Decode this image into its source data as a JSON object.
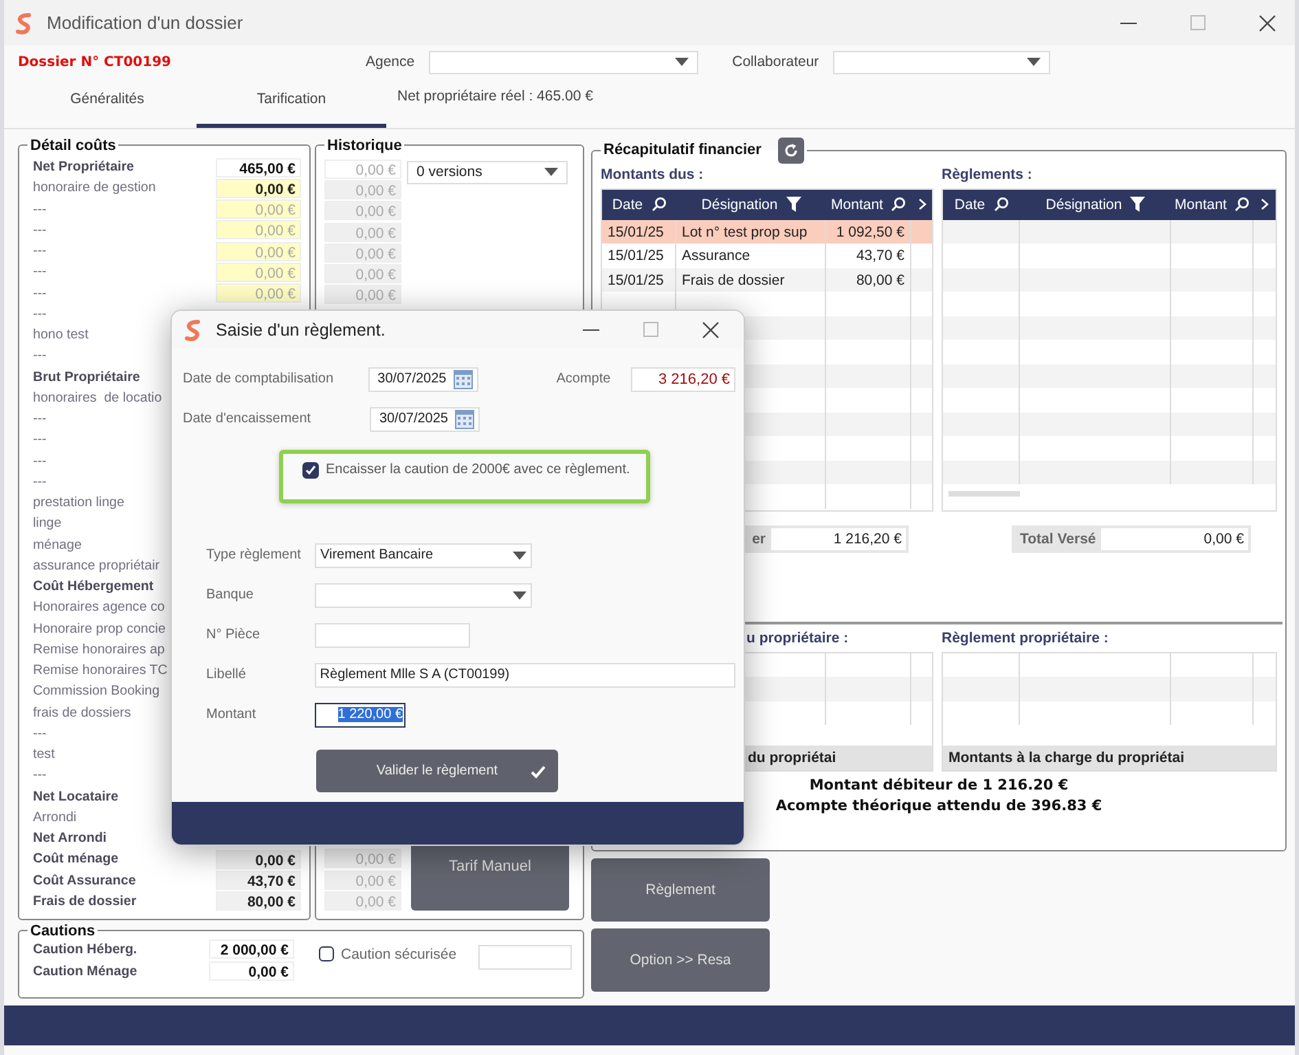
{
  "window": {
    "title": "Modification d'un dossier"
  },
  "header": {
    "dossier": "Dossier N° CT00199",
    "agence_label": "Agence",
    "collaborateur_label": "Collaborateur",
    "net_reel": "Net propriétaire réel : 465.00 €"
  },
  "tabs": [
    {
      "label": "Généralités",
      "selected": false
    },
    {
      "label": "Tarification",
      "selected": true
    }
  ],
  "detail_couts": {
    "title": "Détail coûts",
    "rows": [
      {
        "label": "Net Propriétaire",
        "kind": "total",
        "value": {
          "text": "465,00 €",
          "kind": "total"
        }
      },
      {
        "label": "honoraire de gestion",
        "kind": "item",
        "value": {
          "text": "0,00 €",
          "kind": "input"
        }
      },
      {
        "label": "---",
        "kind": "item",
        "value": {
          "text": "0,00 €",
          "kind": "default"
        }
      },
      {
        "label": "---",
        "kind": "item",
        "value": {
          "text": "0,00 €",
          "kind": "default"
        }
      },
      {
        "label": "---",
        "kind": "item",
        "value": {
          "text": "0,00 €",
          "kind": "default"
        }
      },
      {
        "label": "---",
        "kind": "item",
        "value": {
          "text": "0,00 €",
          "kind": "default"
        }
      },
      {
        "label": "---",
        "kind": "item",
        "value": {
          "text": "0,00 €",
          "kind": "default"
        }
      },
      {
        "label": "---",
        "kind": "item"
      },
      {
        "label": "hono test",
        "kind": "item"
      },
      {
        "label": "---",
        "kind": "item"
      },
      {
        "label": "Brut Propriétaire",
        "kind": "total"
      },
      {
        "label": "honoraires  de locatio",
        "kind": "item"
      },
      {
        "label": "---",
        "kind": "item"
      },
      {
        "label": "---",
        "kind": "item"
      },
      {
        "label": "---",
        "kind": "item"
      },
      {
        "label": "---",
        "kind": "item"
      },
      {
        "label": "prestation linge",
        "kind": "item"
      },
      {
        "label": "linge",
        "kind": "item"
      },
      {
        "label": "ménage",
        "kind": "item"
      },
      {
        "label": "assurance propriétair",
        "kind": "item"
      },
      {
        "label": "Coût Hébergement",
        "kind": "total"
      },
      {
        "label": "Honoraires agence co",
        "kind": "item"
      },
      {
        "label": "Honoraire prop concie",
        "kind": "item"
      },
      {
        "label": "Remise honoraires ap",
        "kind": "item"
      },
      {
        "label": "Remise honoraires TC",
        "kind": "item"
      },
      {
        "label": "Commission Booking",
        "kind": "item"
      },
      {
        "label": "frais de dossiers",
        "kind": "item"
      },
      {
        "label": "---",
        "kind": "item"
      },
      {
        "label": "test",
        "kind": "item"
      },
      {
        "label": "---",
        "kind": "item"
      },
      {
        "label": "Net Locataire",
        "kind": "total"
      },
      {
        "label": "Arrondi",
        "kind": "item"
      },
      {
        "label": "Net Arrondi",
        "kind": "total"
      },
      {
        "label": "Coût ménage",
        "kind": "total",
        "value": {
          "text": "0,00 €",
          "kind": "computed"
        }
      },
      {
        "label": "Coût Assurance",
        "kind": "total",
        "value": {
          "text": "43,70 €",
          "kind": "computed"
        }
      },
      {
        "label": "Frais de dossier",
        "kind": "total",
        "value": {
          "text": "80,00 €",
          "kind": "computed"
        }
      }
    ]
  },
  "historique": {
    "title": "Historique",
    "versions": "0 versions",
    "top_values": [
      {
        "text": "0,00 €",
        "kind": "current"
      },
      {
        "text": "0,00 €",
        "kind": "past"
      },
      {
        "text": "0,00 €",
        "kind": "past"
      },
      {
        "text": "0,00 €",
        "kind": "past"
      },
      {
        "text": "0,00 €",
        "kind": "past"
      },
      {
        "text": "0,00 €",
        "kind": "past"
      },
      {
        "text": "0,00 €",
        "kind": "past"
      }
    ],
    "bottom_values": [
      {
        "text": "0,00 €",
        "kind": "past"
      },
      {
        "text": "0,00 €",
        "kind": "past"
      },
      {
        "text": "0,00 €",
        "kind": "past"
      }
    ],
    "button": "Tarif Manuel"
  },
  "cautions": {
    "title": "Cautions",
    "rows": [
      {
        "label": "Caution Héberg.",
        "value": "2 000,00 €"
      },
      {
        "label": "Caution Ménage",
        "value": "0,00 €"
      }
    ],
    "securisee": {
      "label": "Caution sécurisée",
      "checked": false
    }
  },
  "recap": {
    "title": "Récapitulatif financier",
    "montants_dus": {
      "title": "Montants dus :",
      "columns": [
        "Date",
        "Désignation",
        "Montant"
      ],
      "rows": [
        {
          "cells": [
            "15/01/25",
            "Lot n° test prop sup",
            "1 092,50 €"
          ],
          "selected": true
        },
        {
          "cells": [
            "15/01/25",
            "Assurance",
            "43,70 €"
          ],
          "selected": false
        },
        {
          "cells": [
            "15/01/25",
            "Frais de dossier",
            "80,00 €"
          ],
          "selected": false
        }
      ]
    },
    "reglements": {
      "title": "Règlements :",
      "columns": [
        "Date",
        "Désignation",
        "Montant"
      ]
    },
    "total_du": {
      "label": "er",
      "value": "1 216,20 €"
    },
    "total_verse": {
      "label": "Total Versé",
      "value": "0,00 €"
    },
    "dus_proprietaire": {
      "title": "u propriétaire :",
      "footer": "du propriétai"
    },
    "reglement_proprietaire": {
      "title": "Règlement propriétaire :",
      "footer": "Montants à la charge du propriétai"
    },
    "summary": [
      "Montant débiteur de 1 216.20 €",
      "Acompte théorique attendu de 396.83 €"
    ]
  },
  "actions": [
    "Règlement",
    "Option >> Resa"
  ],
  "dialog": {
    "title": "Saisie d'un règlement.",
    "date_compta": {
      "label": "Date de comptabilisation",
      "value": "30/07/2025"
    },
    "acompte": {
      "label": "Acompte",
      "value": "3 216,20 €"
    },
    "date_encaissement": {
      "label": "Date d'encaissement",
      "value": "30/07/2025"
    },
    "encaisser_caution": {
      "label": "Encaisser la caution de 2000€ avec ce règlement.",
      "checked": true
    },
    "type_reglement": {
      "label": "Type règlement",
      "value": "Virement Bancaire"
    },
    "banque": {
      "label": "Banque"
    },
    "piece": {
      "label": "N° Pièce"
    },
    "libelle": {
      "label": "Libellé",
      "value": "Règlement Mlle S A (CT00199)"
    },
    "montant": {
      "label": "Montant",
      "value": "1 220,00 €",
      "text_selected": true
    },
    "submit": "Valider le règlement"
  }
}
